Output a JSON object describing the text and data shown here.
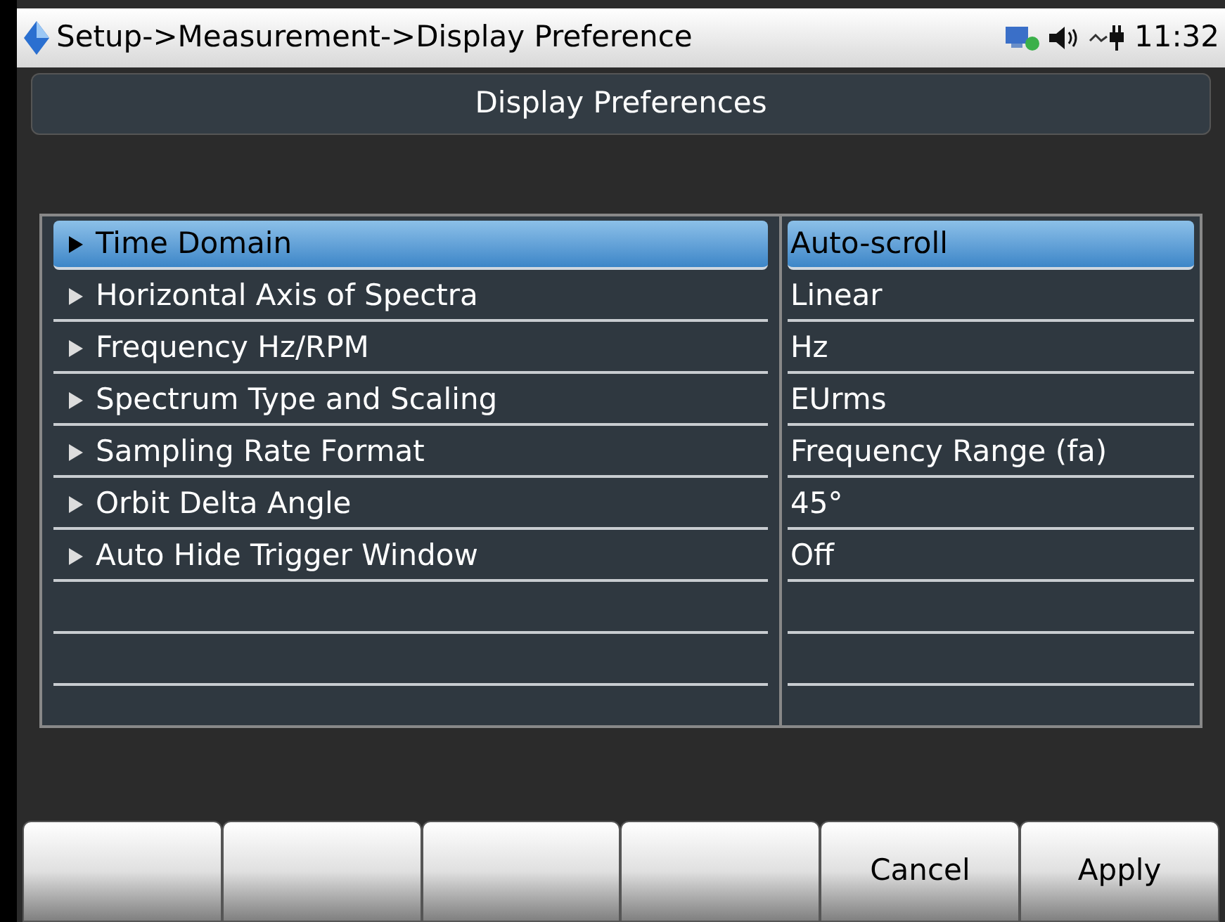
{
  "status_bar": {
    "breadcrumb": "Setup->Measurement->Display Preference",
    "time": "11:32"
  },
  "header": {
    "title": "Display Preferences"
  },
  "settings": [
    {
      "label": "Time Domain",
      "value": "Auto-scroll",
      "selected": true
    },
    {
      "label": "Horizontal Axis of Spectra",
      "value": "Linear",
      "selected": false
    },
    {
      "label": "Frequency Hz/RPM",
      "value": "Hz",
      "selected": false
    },
    {
      "label": "Spectrum Type and Scaling",
      "value": "EUrms",
      "selected": false
    },
    {
      "label": "Sampling Rate Format",
      "value": "Frequency Range (fa)",
      "selected": false
    },
    {
      "label": "Orbit Delta Angle",
      "value": "45°",
      "selected": false
    },
    {
      "label": "Auto Hide Trigger Window",
      "value": "Off",
      "selected": false
    }
  ],
  "softkeys": [
    {
      "kind": "blank"
    },
    {
      "kind": "blank"
    },
    {
      "kind": "blank"
    },
    {
      "kind": "blank"
    },
    {
      "kind": "labeled",
      "label": "Cancel"
    },
    {
      "kind": "labeled",
      "label": "Apply"
    }
  ]
}
